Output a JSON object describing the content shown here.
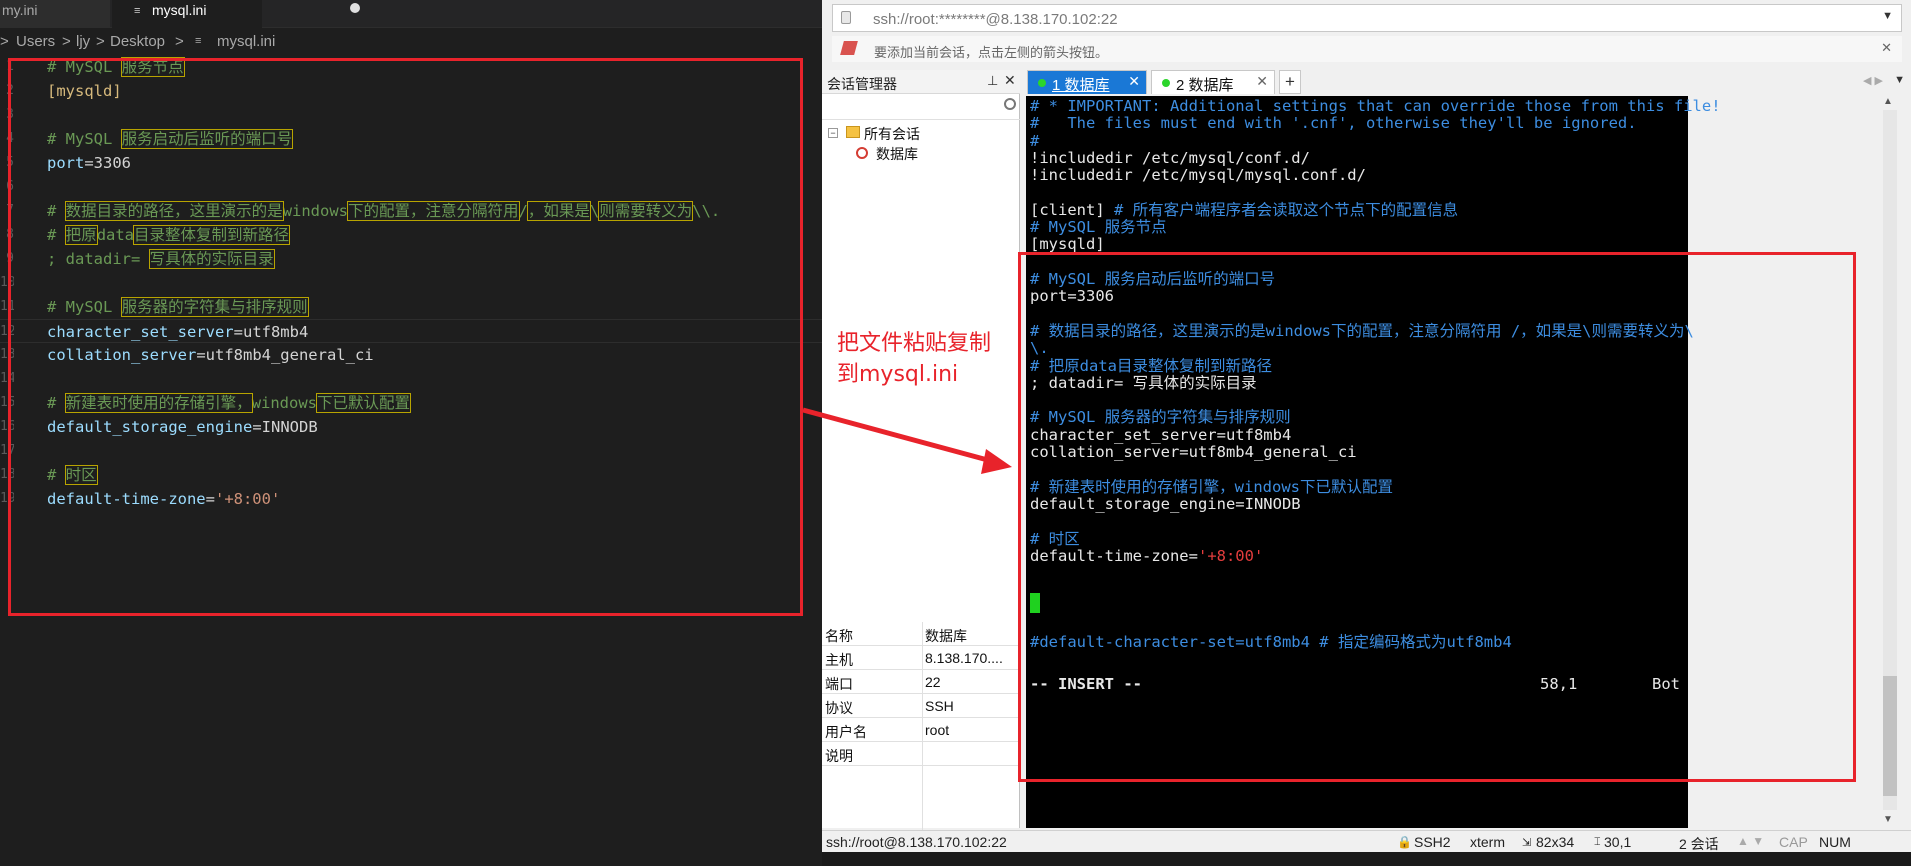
{
  "vscode": {
    "tabs": [
      {
        "label": "my.ini"
      },
      {
        "label": "mysql.ini",
        "modified": true
      }
    ],
    "breadcrumbs": [
      "Users",
      "ljy",
      "Desktop",
      "mysql.ini"
    ],
    "breadcrumb_sep": ">",
    "lines": [
      {
        "n": "1",
        "parts": [
          {
            "c": "cm",
            "t": "# MySQL "
          },
          {
            "c": "bx",
            "t": "服务节点"
          }
        ]
      },
      {
        "n": "2",
        "parts": [
          {
            "c": "sec",
            "t": "[mysqld]"
          }
        ]
      },
      {
        "n": "3",
        "parts": []
      },
      {
        "n": "4",
        "parts": [
          {
            "c": "cm",
            "t": "# MySQL "
          },
          {
            "c": "bx",
            "t": "服务启动后监听的端口号"
          }
        ]
      },
      {
        "n": "5",
        "parts": [
          {
            "c": "key",
            "t": "port"
          },
          {
            "c": "eq",
            "t": "="
          },
          {
            "c": "val",
            "t": "3306"
          }
        ]
      },
      {
        "n": "6",
        "parts": []
      },
      {
        "n": "7",
        "parts": [
          {
            "c": "cm",
            "t": "# "
          },
          {
            "c": "bx",
            "t": "数据目录的路径，这里演示的是"
          },
          {
            "c": "cm",
            "t": "windows"
          },
          {
            "c": "bx",
            "t": "下的配置，注意分隔符用"
          },
          {
            "c": "cm",
            "t": "/"
          },
          {
            "c": "bx",
            "t": "，如果是"
          },
          {
            "c": "cm",
            "t": "\\"
          },
          {
            "c": "bx",
            "t": "则需要转义为"
          },
          {
            "c": "cm",
            "t": "\\\\."
          }
        ]
      },
      {
        "n": "8",
        "parts": [
          {
            "c": "cm",
            "t": "# "
          },
          {
            "c": "bx",
            "t": "把原"
          },
          {
            "c": "cm",
            "t": "data"
          },
          {
            "c": "bx",
            "t": "目录整体复制到新路径"
          }
        ]
      },
      {
        "n": "9",
        "parts": [
          {
            "c": "semi",
            "t": "; datadir= "
          },
          {
            "c": "bx",
            "t": "写具体的实际目录"
          }
        ]
      },
      {
        "n": "10",
        "parts": []
      },
      {
        "n": "11",
        "parts": [
          {
            "c": "cm",
            "t": "# MySQL "
          },
          {
            "c": "bx",
            "t": "服务器的字符集与排序规则"
          }
        ]
      },
      {
        "n": "12",
        "parts": [
          {
            "c": "key",
            "t": "character_set_server"
          },
          {
            "c": "eq",
            "t": "="
          },
          {
            "c": "val",
            "t": "utf8mb4"
          }
        ]
      },
      {
        "n": "13",
        "parts": [
          {
            "c": "key",
            "t": "collation_server"
          },
          {
            "c": "eq",
            "t": "="
          },
          {
            "c": "val",
            "t": "utf8mb4_general_ci"
          }
        ]
      },
      {
        "n": "14",
        "parts": []
      },
      {
        "n": "15",
        "parts": [
          {
            "c": "cm",
            "t": "# "
          },
          {
            "c": "bx",
            "t": "新建表时使用的存储引擎，"
          },
          {
            "c": "cm",
            "t": "windows"
          },
          {
            "c": "bx",
            "t": "下已默认配置"
          }
        ]
      },
      {
        "n": "16",
        "parts": [
          {
            "c": "key",
            "t": "default_storage_engine"
          },
          {
            "c": "eq",
            "t": "="
          },
          {
            "c": "val",
            "t": "INNODB"
          }
        ]
      },
      {
        "n": "17",
        "parts": []
      },
      {
        "n": "18",
        "parts": [
          {
            "c": "cm",
            "t": "# "
          },
          {
            "c": "bx",
            "t": "时区"
          }
        ]
      },
      {
        "n": "19",
        "parts": [
          {
            "c": "key",
            "t": "default-time-zone"
          },
          {
            "c": "eq",
            "t": "="
          },
          {
            "c": "str",
            "t": "'+8:00'"
          }
        ]
      }
    ]
  },
  "xshell": {
    "address": "ssh://root:********@8.138.170.102:22",
    "hint": "要添加当前会话，点击左侧的箭头按钮。",
    "session_manager": {
      "title": "会话管理器",
      "pin_icon": "pin-icon",
      "close_glyph": "✕",
      "tree": [
        {
          "label": "所有会话",
          "kind": "folder",
          "expander": "⊟"
        },
        {
          "label": "数据库",
          "kind": "session"
        }
      ]
    },
    "properties": [
      {
        "k": "名称",
        "v": "数据库"
      },
      {
        "k": "主机",
        "v": "8.138.170...."
      },
      {
        "k": "端口",
        "v": "22"
      },
      {
        "k": "协议",
        "v": "SSH"
      },
      {
        "k": "用户名",
        "v": "root"
      },
      {
        "k": "说明",
        "v": ""
      }
    ],
    "tabs": [
      {
        "label": "1 数据库",
        "active": true
      },
      {
        "label": "2 数据库",
        "active": false
      }
    ],
    "tab_close": "✕",
    "tab_add": "+",
    "terminal_lines": [
      [
        {
          "c": "cm",
          "t": "# * IMPORTANT: Additional settings that can override those from this file!"
        }
      ],
      [
        {
          "c": "cm",
          "t": "#   The files must end with '.cnf', otherwise they'll be ignored."
        }
      ],
      [
        {
          "c": "cm",
          "t": "#"
        }
      ],
      [
        {
          "c": "norm",
          "t": "!includedir /etc/mysql/conf.d/"
        }
      ],
      [
        {
          "c": "norm",
          "t": "!includedir /etc/mysql/mysql.conf.d/"
        }
      ],
      [],
      [
        {
          "c": "norm",
          "t": "[client] "
        },
        {
          "c": "cm",
          "t": "# 所有客户端程序者会读取这个节点下的配置信息"
        }
      ],
      [
        {
          "c": "cm",
          "t": "# MySQL 服务节点"
        }
      ],
      [
        {
          "c": "norm",
          "t": "[mysqld]"
        }
      ],
      [],
      [
        {
          "c": "cm",
          "t": "# MySQL 服务启动后监听的端口号"
        }
      ],
      [
        {
          "c": "norm",
          "t": "port=3306"
        }
      ],
      [],
      [
        {
          "c": "cm",
          "t": "# 数据目录的路径，这里演示的是windows下的配置，注意分隔符用 /，如果是\\则需要转义为\\"
        }
      ],
      [
        {
          "c": "cm",
          "t": "\\."
        }
      ],
      [
        {
          "c": "cm",
          "t": "# 把原data目录整体复制到新路径"
        }
      ],
      [
        {
          "c": "norm",
          "t": "; datadir= 写具体的实际目录"
        }
      ],
      [],
      [
        {
          "c": "cm",
          "t": "# MySQL 服务器的字符集与排序规则"
        }
      ],
      [
        {
          "c": "norm",
          "t": "character_set_server=utf8mb4"
        }
      ],
      [
        {
          "c": "norm",
          "t": "collation_server=utf8mb4_general_ci"
        }
      ],
      [],
      [
        {
          "c": "cm",
          "t": "# 新建表时使用的存储引擎，windows下已默认配置"
        }
      ],
      [
        {
          "c": "norm",
          "t": "default_storage_engine=INNODB"
        }
      ],
      [],
      [
        {
          "c": "cm",
          "t": "# 时区"
        }
      ],
      [
        {
          "c": "norm",
          "t": "default-time-zone="
        },
        {
          "c": "str",
          "t": "'+8:00'"
        }
      ],
      [],
      [],
      [],
      [],
      [
        {
          "c": "cm",
          "t": "#default-character-set=utf8mb4 # 指定编码格式为utf8mb4"
        }
      ],
      [],
      []
    ],
    "vim_mode": "-- INSERT --",
    "vim_pos": "58,1",
    "vim_scroll": "Bot",
    "status": {
      "connection": "ssh://root@8.138.170.102:22",
      "protocol": "SSH2",
      "term": "xterm",
      "size": "82x34",
      "cursor": "30,1",
      "sessions": "2 会话",
      "cap": "CAP",
      "num": "NUM"
    }
  },
  "annotation": {
    "text_line1": "把文件粘贴复制",
    "text_line2": "到mysql.ini",
    "color": "#e8232b"
  }
}
